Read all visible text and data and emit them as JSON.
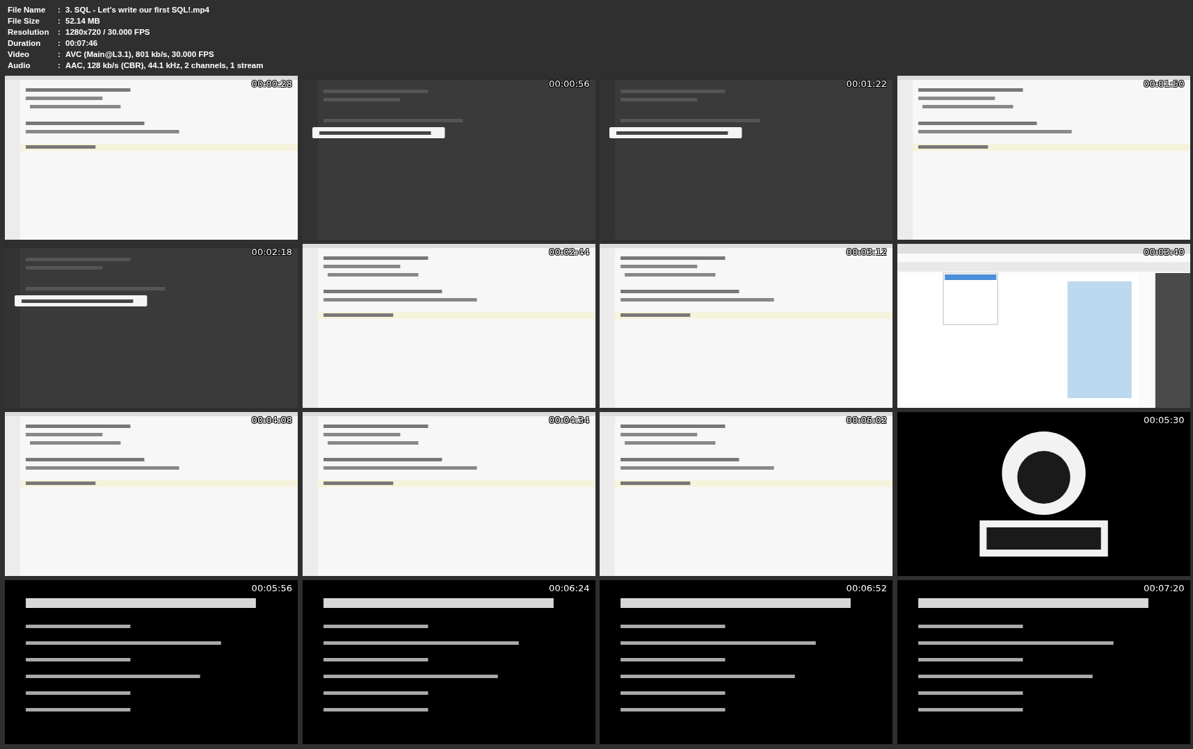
{
  "info": [
    {
      "label": "File Name",
      "separator": ":",
      "value": "3. SQL - Let's write our first SQL!.mp4"
    },
    {
      "label": "File Size",
      "separator": ":",
      "value": "52.14 MB"
    },
    {
      "label": "Resolution",
      "separator": ":",
      "value": "1280x720 / 30.000 FPS"
    },
    {
      "label": "Duration",
      "separator": ":",
      "value": "00:07:46"
    },
    {
      "label": "Video",
      "separator": ":",
      "value": "AVC (Main@L3.1), 801 kb/s, 30.000 FPS"
    },
    {
      "label": "Audio",
      "separator": ":",
      "value": "AAC, 128 kb/s (CBR), 44.1 kHz, 2 channels, 1 stream"
    }
  ],
  "frames": [
    {
      "time": "00:00:28",
      "kind": "picture"
    },
    {
      "time": "00:00:56",
      "kind": "picture"
    },
    {
      "time": "00:01:22",
      "kind": "picture"
    },
    {
      "time": "00:01:50",
      "kind": "picture"
    },
    {
      "time": "00:02:18",
      "kind": "picture"
    },
    {
      "time": "00:02:44",
      "kind": "picture"
    },
    {
      "time": "00:03:12",
      "kind": "picture"
    },
    {
      "time": "00:03:40",
      "kind": "picture"
    },
    {
      "time": "00:04:08",
      "kind": "picture"
    },
    {
      "time": "00:04:34",
      "kind": "picture"
    },
    {
      "time": "00:05:02",
      "kind": "picture"
    },
    {
      "time": "00:05:30",
      "kind": "picture"
    },
    {
      "time": "00:05:56",
      "kind": "picture"
    },
    {
      "time": "00:06:24",
      "kind": "picture"
    },
    {
      "time": "00:06:52",
      "kind": "picture"
    },
    {
      "time": "00:07:20",
      "kind": "picture"
    }
  ]
}
